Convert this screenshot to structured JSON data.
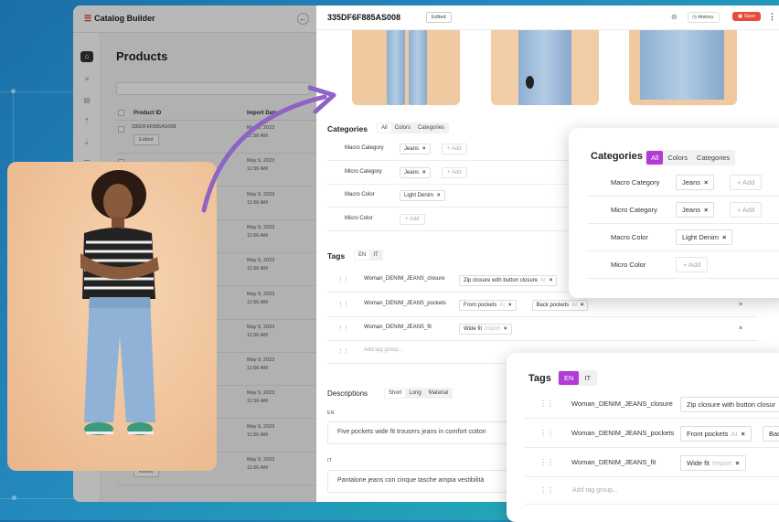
{
  "app": {
    "logo": "Catalog Builder",
    "page_title": "Products",
    "columns": [
      "Product ID",
      "Import Date"
    ],
    "rows": [
      {
        "id": "335DF6F885AS008",
        "badge": "Edited",
        "date": "May 9, 2023",
        "time": "11:56 AM"
      },
      {
        "id": "",
        "badge": "",
        "date": "May 9, 2023",
        "time": "11:56 AM"
      },
      {
        "id": "",
        "badge": "",
        "date": "May 9, 2023",
        "time": "11:56 AM"
      },
      {
        "id": "",
        "badge": "",
        "date": "May 9, 2023",
        "time": "11:56 AM"
      },
      {
        "id": "",
        "badge": "",
        "date": "May 9, 2023",
        "time": "11:56 AM"
      },
      {
        "id": "",
        "badge": "",
        "date": "May 9, 2023",
        "time": "11:56 AM"
      },
      {
        "id": "",
        "badge": "",
        "date": "May 9, 2023",
        "time": "11:56 AM"
      },
      {
        "id": "",
        "badge": "",
        "date": "May 9, 2023",
        "time": "11:56 AM"
      },
      {
        "id": "",
        "badge": "",
        "date": "May 9, 2023",
        "time": "11:56 AM"
      },
      {
        "id": "",
        "badge": "",
        "date": "May 9, 2023",
        "time": "11:56 AM"
      },
      {
        "id": "",
        "badge": "Edited",
        "date": "May 9, 2023",
        "time": "11:56 AM"
      }
    ]
  },
  "panel": {
    "title": "335DF6F885AS008",
    "status": "Edited",
    "history_label": "History",
    "save_label": "Save",
    "categories_title": "Categories",
    "category_tabs": [
      "All",
      "Colors",
      "Categories"
    ],
    "category_rows": [
      {
        "label": "Macro Category",
        "chips": [
          "Jeans"
        ],
        "add": "+ Add"
      },
      {
        "label": "Micro Category",
        "chips": [
          "Jeans"
        ],
        "add": "+ Add"
      },
      {
        "label": "Macro Color",
        "chips": [
          "Light Denim"
        ],
        "add": ""
      },
      {
        "label": "Micro Color",
        "chips": [],
        "add": "+ Add"
      }
    ],
    "tags_title": "Tags",
    "tag_langs": [
      "EN",
      "IT"
    ],
    "tag_rows": [
      {
        "name": "Woman_DENIM_JEANS_closure",
        "chips": [
          {
            "text": "Zip closure with button closure",
            "ai": "AI"
          }
        ]
      },
      {
        "name": "Woman_DENIM_JEANS_pockets",
        "chips": [
          {
            "text": "Front pockets",
            "ai": "AI"
          },
          {
            "text": "Back pockets",
            "ai": "AI"
          }
        ]
      },
      {
        "name": "Woman_DENIM_JEANS_fit",
        "chips": [
          {
            "text": "Wide fit",
            "ai": "Import"
          }
        ]
      }
    ],
    "add_tag_group": "Add tag group...",
    "descriptions_title": "Descriptions",
    "desc_tabs": [
      "Short",
      "Long",
      "Material"
    ],
    "desc_en_lang": "EN",
    "desc_en": "Five pockets wide fit trousers jeans in comfort cotton",
    "desc_it_lang": "IT",
    "desc_it": "Pantalone jeans con cinque tasche ampia vestibilità"
  },
  "zoom_categories": {
    "title": "Categories",
    "tabs": [
      "All",
      "Colors",
      "Categories"
    ],
    "rows": [
      {
        "label": "Macro Category",
        "chips": [
          "Jeans"
        ],
        "add": "+ Add"
      },
      {
        "label": "Micro Category",
        "chips": [
          "Jeans"
        ],
        "add": "+ Add"
      },
      {
        "label": "Macro Color",
        "chips": [
          "Light Denim"
        ],
        "add": ""
      },
      {
        "label": "Micro Color",
        "chips": [],
        "add": "+ Add"
      }
    ]
  },
  "zoom_tags": {
    "title": "Tags",
    "langs": [
      "EN",
      "IT"
    ],
    "rows": [
      {
        "name": "Woman_DENIM_JEANS_closure",
        "chip": "Zip closure with button closur",
        "ai": ""
      },
      {
        "name": "Woman_DENIM_JEANS_pockets",
        "chip": "Front pockets",
        "ai": "AI",
        "chip2": "Bac"
      },
      {
        "name": "Woman_DENIM_JEANS_fit",
        "chip": "Wide fit",
        "ai": "Import"
      }
    ],
    "add": "Add tag group..."
  },
  "colors": {
    "accent_purple": "#b23bd6",
    "save_red": "#e84a3b",
    "background_teal": "#2489bd"
  }
}
